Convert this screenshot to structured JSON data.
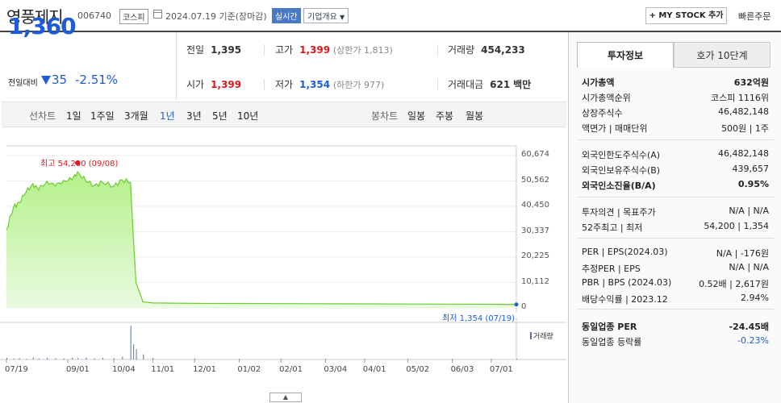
{
  "header": {
    "stock_name": "영풍제지",
    "stock_code": "006740",
    "market": "코스피",
    "date": "2024.07.19 기준(장마감)",
    "realtime_label": "실시간",
    "corp_info_label": "기업개요",
    "my_stock_label": "+ MY STOCK 추가",
    "quick_order_label": "빠른주문"
  },
  "price": {
    "current": "1,360",
    "change_label": "전일대비",
    "change": "35",
    "change_pct": "-2.51%"
  },
  "stats": {
    "prev_close_label": "전일",
    "prev_close": "1,395",
    "high_label": "고가",
    "high": "1,399",
    "upper_limit": "(상한가 1,813)",
    "volume_label": "거래량",
    "volume": "454,233",
    "open_label": "시가",
    "open": "1,399",
    "low_label": "저가",
    "low": "1,354",
    "lower_limit": "(하한가 977)",
    "amount_label": "거래대금",
    "amount": "621",
    "amount_unit": "백만"
  },
  "periods": {
    "line_label": "선차트",
    "line_items": [
      "1일",
      "1주일",
      "3개월",
      "1년",
      "3년",
      "5년",
      "10년"
    ],
    "active": "1년",
    "candle_label": "봉차트",
    "candle_items": [
      "일봉",
      "주봉",
      "월봉"
    ]
  },
  "chart_data": {
    "type": "area",
    "y_ticks": [
      "60,674",
      "50,562",
      "40,450",
      "30,337",
      "20,225",
      "10,112",
      "0"
    ],
    "ylim": [
      0,
      60674
    ],
    "x_ticks": [
      "07/19",
      "09/01",
      "10/04",
      "11/01",
      "12/01",
      "01/02",
      "02/01",
      "03/04",
      "04/01",
      "05/02",
      "06/03",
      "07/01"
    ],
    "high_label": "최고 54,200 (09/08)",
    "low_label": "최저 1,354 (07/19)",
    "volume_label": "거래량",
    "series": [
      {
        "x": [
          "2023-07-19",
          "2023-07-24",
          "2023-07-28",
          "2023-08-02",
          "2023-08-07",
          "2023-08-11",
          "2023-08-17",
          "2023-08-23",
          "2023-08-29",
          "2023-09-04",
          "2023-09-08",
          "2023-09-14",
          "2023-09-20",
          "2023-09-26",
          "2023-10-04",
          "2023-10-10",
          "2023-10-16",
          "2023-10-18",
          "2023-10-20",
          "2023-10-25",
          "2023-11-01",
          "2023-12-01",
          "2024-01-02",
          "2024-02-01",
          "2024-03-04",
          "2024-04-01",
          "2024-05-02",
          "2024-06-03",
          "2024-07-01",
          "2024-07-19"
        ],
        "values": [
          31000,
          40000,
          42000,
          46000,
          49500,
          47000,
          50500,
          48500,
          50800,
          51000,
          54200,
          50500,
          48800,
          50000,
          48400,
          51000,
          50000,
          29000,
          10000,
          2400,
          1950,
          1800,
          1750,
          1700,
          1650,
          1600,
          1550,
          1500,
          1450,
          1354
        ]
      }
    ],
    "volume": [
      0.05,
      0.03,
      0.04,
      0.02,
      0.06,
      0.03,
      0.05,
      0.04,
      0.03,
      0.05,
      0.04,
      0.06,
      0.03,
      0.05,
      0.04,
      0.08,
      1.0,
      0.45,
      0.3,
      0.15,
      0.05,
      0.03,
      0.02,
      0.02,
      0.02,
      0.02,
      0.02,
      0.02,
      0.02,
      0.02
    ]
  },
  "toggle_icon": "chevron-up-icon",
  "side": {
    "tab_active": "투자정보",
    "tab_other": "호가 10단계",
    "rows1": [
      {
        "k": "시가총액",
        "v": "632억원",
        "bold": true
      },
      {
        "k": "시가총액순위",
        "v": "코스피 1116위"
      },
      {
        "k": "상장주식수",
        "v": "46,482,148"
      },
      {
        "k": "액면가 | 매매단위",
        "v": "500원 | 1주"
      }
    ],
    "rows2": [
      {
        "k": "외국인한도주식수(A)",
        "v": "46,482,148"
      },
      {
        "k": "외국인보유주식수(B)",
        "v": "439,657"
      },
      {
        "k": "외국인소진율(B/A)",
        "v": "0.95%",
        "bold": true
      }
    ],
    "rows3": [
      {
        "k": "투자의견 | 목표주가",
        "v": "N/A | N/A"
      },
      {
        "k": "52주최고 | 최저",
        "v": "54,200 | 1,354"
      }
    ],
    "rows4": [
      {
        "k": "PER | EPS(2024.03)",
        "v": "N/A | -176원"
      },
      {
        "k": "추정PER | EPS",
        "v": "N/A | N/A"
      },
      {
        "k": "PBR | BPS (2024.03)",
        "v": "0.52배 | 2,617원"
      },
      {
        "k": "배당수익률 | 2023.12",
        "v": "2.94%"
      }
    ],
    "rows5": [
      {
        "k": "동일업종 PER",
        "v": "-24.45배",
        "bold": true
      },
      {
        "k": "동일업종 등락률",
        "v": "-0.23%",
        "blue": true
      }
    ]
  }
}
